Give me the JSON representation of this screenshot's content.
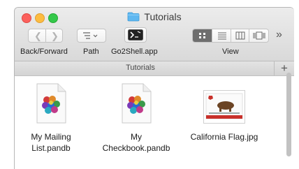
{
  "window": {
    "title": "Tutorials"
  },
  "toolbar": {
    "back_forward_label": "Back/Forward",
    "path_label": "Path",
    "go2shell_label": "Go2Shell.app",
    "view_label": "View",
    "overflow_glyph": "»"
  },
  "pathbar": {
    "title": "Tutorials",
    "add_glyph": "+"
  },
  "files": [
    {
      "name_line1": "My Mailing",
      "name_line2": "List.pandb",
      "icon": "pandb-document-icon"
    },
    {
      "name_line1": "My",
      "name_line2": "Checkbook.pandb",
      "icon": "pandb-document-icon"
    },
    {
      "name_line1": "California Flag.jpg",
      "name_line2": "",
      "icon": "california-flag-image-icon"
    }
  ],
  "colors": {
    "close": "#fc615d",
    "minimize": "#fdbc40",
    "zoom": "#34c84a",
    "folder": "#5eb7f0"
  }
}
